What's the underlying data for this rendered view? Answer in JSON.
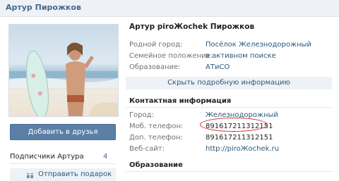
{
  "header": {
    "title": "Артур Пирожков"
  },
  "left": {
    "add_friend_label": "Добавить в друзья",
    "subscribers_label": "Подписчики Артура",
    "subscribers_count": "4",
    "gift_label": "Отправить подарок"
  },
  "profile": {
    "name": "Артур piroЖochek Пирожков",
    "rows": [
      {
        "label": "Родной город:",
        "value": "Посёлок Железнодорожный"
      },
      {
        "label": "Семейное положение:",
        "value": "в активном поиске"
      },
      {
        "label": "Образование:",
        "value": "АТиСО"
      }
    ],
    "show_more_label": "Скрыть подробную информацию"
  },
  "contacts": {
    "title": "Контактная информация",
    "rows": [
      {
        "label": "Город:",
        "value": "Железнодорожный"
      },
      {
        "label": "Моб. телефон:",
        "value": "891617211312151"
      },
      {
        "label": "Доп. телефон:",
        "value": "891617211312151"
      },
      {
        "label": "Веб-сайт:",
        "value": "http://piroЖochek.ru"
      }
    ]
  },
  "education": {
    "title": "Образование"
  },
  "colors": {
    "accent": "#5b7fa6",
    "link": "#2b587a",
    "header_bg": "#eef2f6",
    "highlight": "#cc2a2a"
  }
}
